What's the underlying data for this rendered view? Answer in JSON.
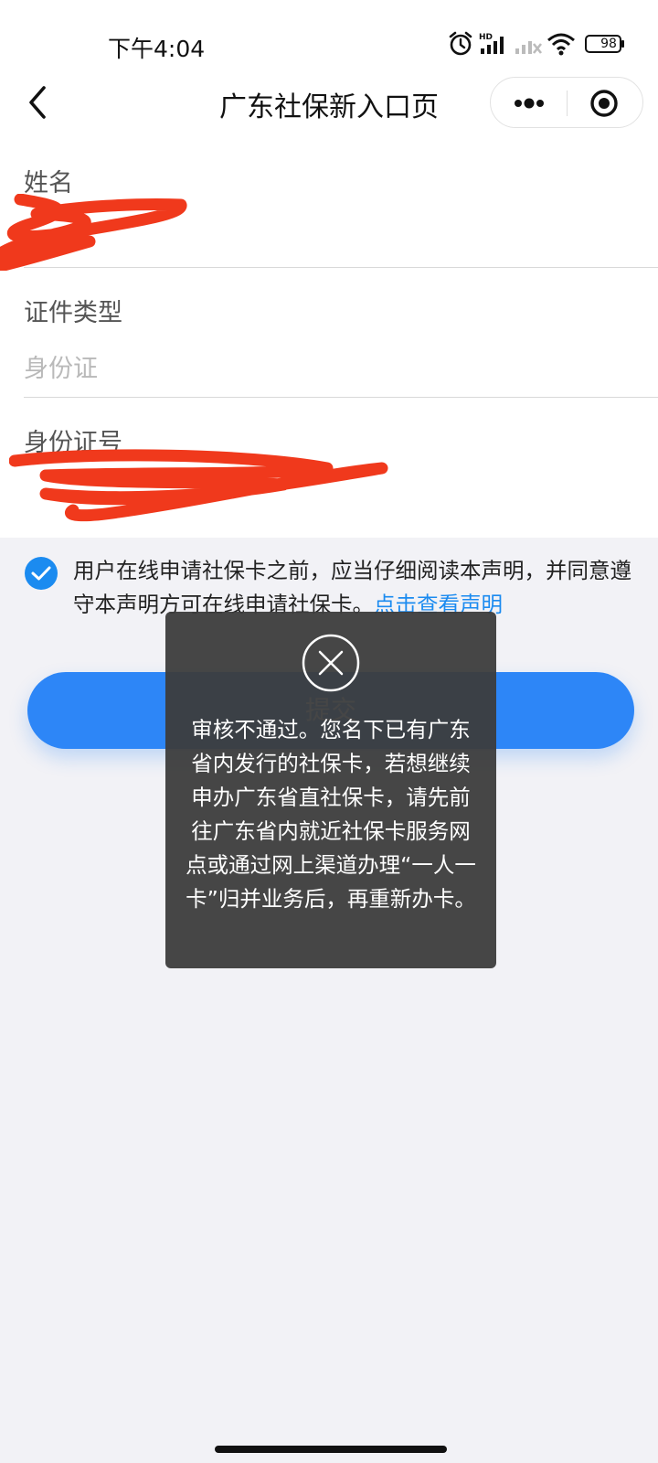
{
  "status_bar": {
    "time": "下午4:04",
    "battery": "98",
    "icons": [
      "alarm-icon",
      "hd-signal-icon",
      "signal-icon",
      "no-signal-icon",
      "wifi-icon",
      "battery-icon"
    ]
  },
  "nav": {
    "title": "广东社保新入口页",
    "icons": [
      "back-arrow-icon",
      "more-dots-icon",
      "miniapp-close-icon"
    ]
  },
  "form": {
    "name": {
      "label": "姓名",
      "value": ""
    },
    "id_type": {
      "label": "证件类型",
      "value": "身份证"
    },
    "id_number": {
      "label": "身份证号",
      "value": ""
    }
  },
  "agreement": {
    "checked": true,
    "text": "用户在线申请社保卡之前，应当仔细阅读本声明，并同意遵守本声明方可在线申请社保卡。",
    "link_text": "点击查看声明"
  },
  "submit": {
    "label": "提交"
  },
  "toast": {
    "icon": "close-circle-icon",
    "message": "审核不通过。您名下已有广东省内发行的社保卡，若想继续申办广东省直社保卡，请先前往广东省内就近社保卡服务网点或通过网上渠道办理“一人一卡”归并业务后，再重新办卡。"
  },
  "colors": {
    "accent": "#2d86f7",
    "link": "#1b8bf0",
    "redaction": "#f0391c",
    "toast_bg": "#3c3c3c"
  }
}
